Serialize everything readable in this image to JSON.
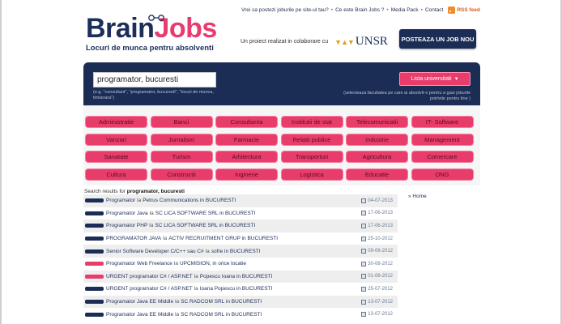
{
  "topbar": {
    "links": [
      "Vrei sa postezi joburile pe site-ul tau?",
      "Ce este Brain Jobs ?",
      "Media Pack",
      "Contact"
    ],
    "rss_label": "RSS feed"
  },
  "logo": {
    "word1": "Brain",
    "word2": "Jobs",
    "tagline": "Locuri de munca pentru absolventi"
  },
  "collab": {
    "text": "Un proiect realizat in colaborare cu",
    "partner": "UNSR"
  },
  "post_button": "POSTEAZA UN JOB NOU",
  "search": {
    "value": "programator, bucuresti",
    "hint": "(e.g. \"consultant\", \"programator, bucuresti\", \"locuri de munca, timisoara\")",
    "univ_button": "Lista universitati",
    "univ_hint": "(selecteaza facultatea pe care ai absolvit-o pentru a gasi joburile potrivite pentru tine )"
  },
  "categories": [
    [
      "Administratie",
      "Banci",
      "Consultanta",
      "Institutii de stat",
      "Telecomunicatii",
      "IT- Software"
    ],
    [
      "Vanzari",
      "Jurnalism",
      "Farmacie",
      "Relatii publice",
      "Industrie",
      "Management"
    ],
    [
      "Sanatate",
      "Turism",
      "Arhitectura",
      "Transporturi",
      "Agricultura",
      "Comercare"
    ],
    [
      "Cultura",
      "Constructii",
      "Inginerie",
      "Logistica",
      "Educatie",
      "ONG"
    ]
  ],
  "results": {
    "prefix": "Search results for",
    "query": "programator, bucuresti",
    "rows": [
      {
        "job": "Programator",
        "mid": "la",
        "comp": "Petrus Communications in BUCURESTI",
        "date": "04-07-2013",
        "badge": "navy"
      },
      {
        "job": "Programator Java",
        "mid": "la",
        "comp": "SC LICA SOFTWARE SRL in BUCURESTI",
        "date": "17-06-2013",
        "badge": "navy"
      },
      {
        "job": "Programator PHP",
        "mid": "la",
        "comp": "SC LICA SOFTWARE SRL in BUCURESTI",
        "date": "17-06-2013",
        "badge": "navy"
      },
      {
        "job": "PROGRAMATOR JAVA",
        "mid": "la",
        "comp": "ACTIV RECRUITMENT GRUP in BUCURESTI",
        "date": "25-10-2012",
        "badge": "navy"
      },
      {
        "job": "Senior Software Developer C/C++ sau C#",
        "mid": "la",
        "comp": "sofre in BUCURESTI",
        "date": "09-09-2012",
        "badge": "navy"
      },
      {
        "job": "Programator Web Freelance",
        "mid": "la",
        "comp": "UPCMISION, in orice locatie",
        "date": "30-08-2012",
        "badge": "pink"
      },
      {
        "job": "URGENT programator C# / ASP.NET",
        "mid": "la",
        "comp": "Popescu Ioana in BUCURESTI",
        "date": "01-08-2012",
        "badge": "pink"
      },
      {
        "job": "URGENT programator C# / ASP.NET",
        "mid": "la",
        "comp": "Ioana Popescu in BUCURESTI",
        "date": "25-07-2012",
        "badge": "navy"
      },
      {
        "job": "Programator Java EE Middle",
        "mid": "la",
        "comp": "SC RADCOM SRL in BUCURESTI",
        "date": "13-07-2012",
        "badge": "navy"
      },
      {
        "job": "Programator Java EE Middle",
        "mid": "la",
        "comp": "SC RADCOM SRL in BUCURESTI",
        "date": "13-07-2012",
        "badge": "navy"
      }
    ]
  },
  "sidebar": {
    "home": "» Home"
  },
  "colors": {
    "navy": "#1b2d55",
    "pink": "#e83d6a"
  }
}
